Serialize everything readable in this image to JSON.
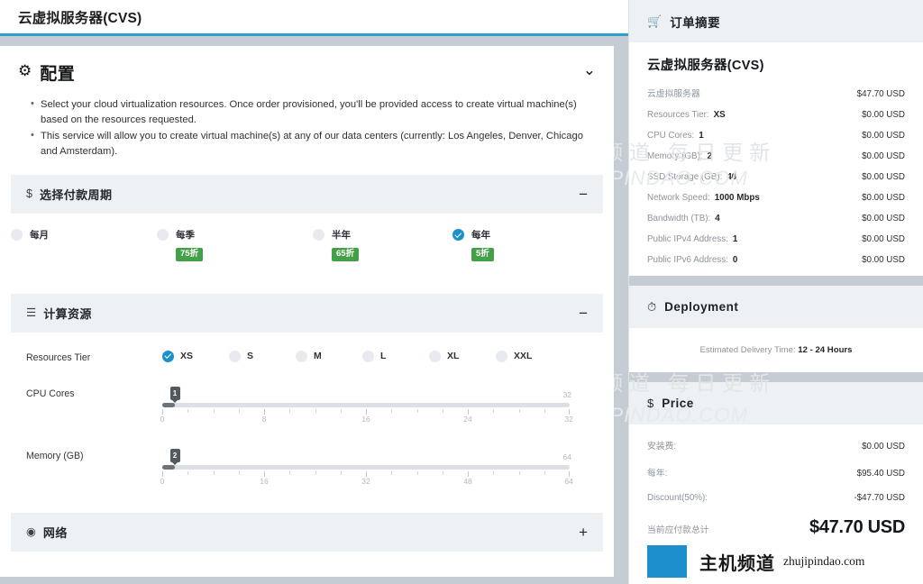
{
  "page_title": "云虚拟服务器(CVS)",
  "configure": {
    "icon": "gear-icon",
    "title": "配置",
    "collapse_icon": "chevron-down-icon",
    "bullets": [
      "Select your cloud virtualization resources. Once order provisioned, you'll be provided access to create virtual machine(s) based on the resources requested.",
      "This service will allow you to create virtual machine(s) at any of our data centers (currently: Los Angeles, Denver, Chicago and Amsterdam)."
    ]
  },
  "billing_cycle": {
    "icon": "dollar-icon",
    "title": "选择付款周期",
    "toggle": "−",
    "options": [
      {
        "label": "每月",
        "badge": "",
        "selected": false
      },
      {
        "label": "每季",
        "badge": "75折",
        "selected": false
      },
      {
        "label": "半年",
        "badge": "65折",
        "selected": false
      },
      {
        "label": "每年",
        "badge": "5折",
        "selected": true
      }
    ]
  },
  "compute": {
    "icon": "server-icon",
    "title": "计算资源",
    "toggle": "−",
    "tier": {
      "label": "Resources Tier",
      "options": [
        {
          "label": "XS",
          "selected": true
        },
        {
          "label": "S",
          "selected": false
        },
        {
          "label": "M",
          "selected": false
        },
        {
          "label": "L",
          "selected": false
        },
        {
          "label": "XL",
          "selected": false
        },
        {
          "label": "XXL",
          "selected": false
        }
      ]
    },
    "cpu": {
      "label": "CPU Cores",
      "value": "1",
      "min": 0,
      "max": 32,
      "max_label": "32",
      "tick_labels": [
        "0",
        "8",
        "16",
        "24",
        "32"
      ]
    },
    "memory": {
      "label": "Memory (GB)",
      "value": "2",
      "min": 0,
      "max": 64,
      "max_label": "64",
      "tick_labels": [
        "0",
        "16",
        "32",
        "48",
        "64"
      ]
    }
  },
  "network": {
    "icon": "globe-icon",
    "title": "网络",
    "toggle": "+"
  },
  "order_summary": {
    "icon": "cart-icon",
    "title": "订单摘要",
    "product": "云虚拟服务器(CVS)",
    "items": [
      {
        "key": "云虚拟服务器",
        "value": "",
        "price": "$47.70 USD"
      },
      {
        "key": "Resources Tier:",
        "value": "XS",
        "price": "$0.00 USD"
      },
      {
        "key": "CPU Cores:",
        "value": "1",
        "price": "$0.00 USD"
      },
      {
        "key": "Memory (GB):",
        "value": "2",
        "price": "$0.00 USD"
      },
      {
        "key": "SSD Storage (GB):",
        "value": "40",
        "price": "$0.00 USD"
      },
      {
        "key": "Network Speed:",
        "value": "1000 Mbps",
        "price": "$0.00 USD"
      },
      {
        "key": "Bandwidth (TB):",
        "value": "4",
        "price": "$0.00 USD"
      },
      {
        "key": "Public IPv4 Address:",
        "value": "1",
        "price": "$0.00 USD"
      },
      {
        "key": "Public IPv6 Address:",
        "value": "0",
        "price": "$0.00 USD"
      }
    ]
  },
  "deployment": {
    "icon": "clock-icon",
    "title": "Deployment",
    "estimate_label": "Estimated Delivery Time:",
    "estimate_value": "12 - 24 Hours"
  },
  "price": {
    "icon": "dollar-icon",
    "title": "Price",
    "rows": [
      {
        "key": "安装费:",
        "amount": "$0.00 USD"
      },
      {
        "key": "每年:",
        "amount": "$95.40 USD"
      },
      {
        "key": "Discount(50%):",
        "amount": "-$47.70 USD"
      }
    ],
    "total": {
      "key": "当前应付款总计",
      "amount": "$47.70 USD"
    }
  },
  "logo": {
    "cn": "主机频道",
    "en": "zhujipindao.com",
    "color": "#1c8fcc"
  },
  "watermark": {
    "cn": "主机频道 每日更新",
    "en": "ZHUJIPINDAO.COM"
  },
  "colors": {
    "accent": "#2b9fd2",
    "radio_on": "#1b91cc",
    "badge": "#43a047",
    "page_bg": "#c5ccd3"
  }
}
